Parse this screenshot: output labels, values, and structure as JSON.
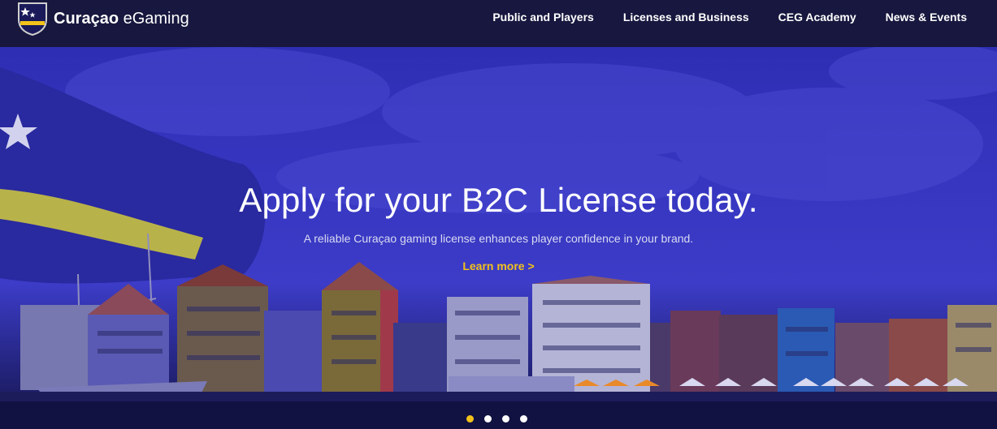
{
  "header": {
    "brand_bold": "Curaçao",
    "brand_light": " eGaming",
    "nav": [
      {
        "label": "Public and Players"
      },
      {
        "label": "Licenses and Business"
      },
      {
        "label": "CEG Academy"
      },
      {
        "label": "News & Events"
      }
    ]
  },
  "hero": {
    "headline": "Apply for your B2C License today.",
    "subline": "A reliable Curaçao gaming license enhances player confidence in your brand.",
    "cta": "Learn more >",
    "carousel": {
      "slides": 4,
      "active_index": 0
    }
  },
  "colors": {
    "nav_bg": "#17173f",
    "hero_blue": "#3737c2",
    "accent_yellow": "#f2c21a",
    "text_white": "#ffffff"
  },
  "icons": {
    "logo": "shield-star-icon",
    "flag": "curacao-flag-icon"
  }
}
